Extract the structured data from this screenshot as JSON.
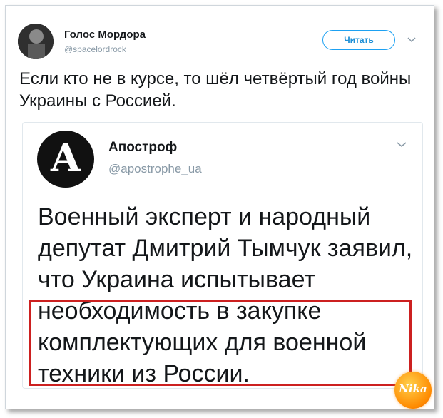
{
  "tweet": {
    "author_name": "Голос Мордора",
    "author_handle": "@spacelordrock",
    "follow_label": "Читать",
    "text": "Если кто не в курсе, то шёл четвёртый год войны Украины с Россией."
  },
  "quoted_tweet": {
    "logo_letter": "A",
    "author_name": "Апостроф",
    "author_handle": "@apostrophe_ua",
    "text": "Военный эксперт и народный депутат Дмитрий Тымчук заявил, что Украина испытывает необходимость в закупке комплектующих для военной техники из России."
  },
  "watermark": {
    "text": "Nika"
  },
  "colors": {
    "accent": "#1da1f2",
    "text": "#14171a",
    "muted": "#8899a6",
    "highlight": "#cc2020",
    "watermark": "#ff8a00"
  }
}
